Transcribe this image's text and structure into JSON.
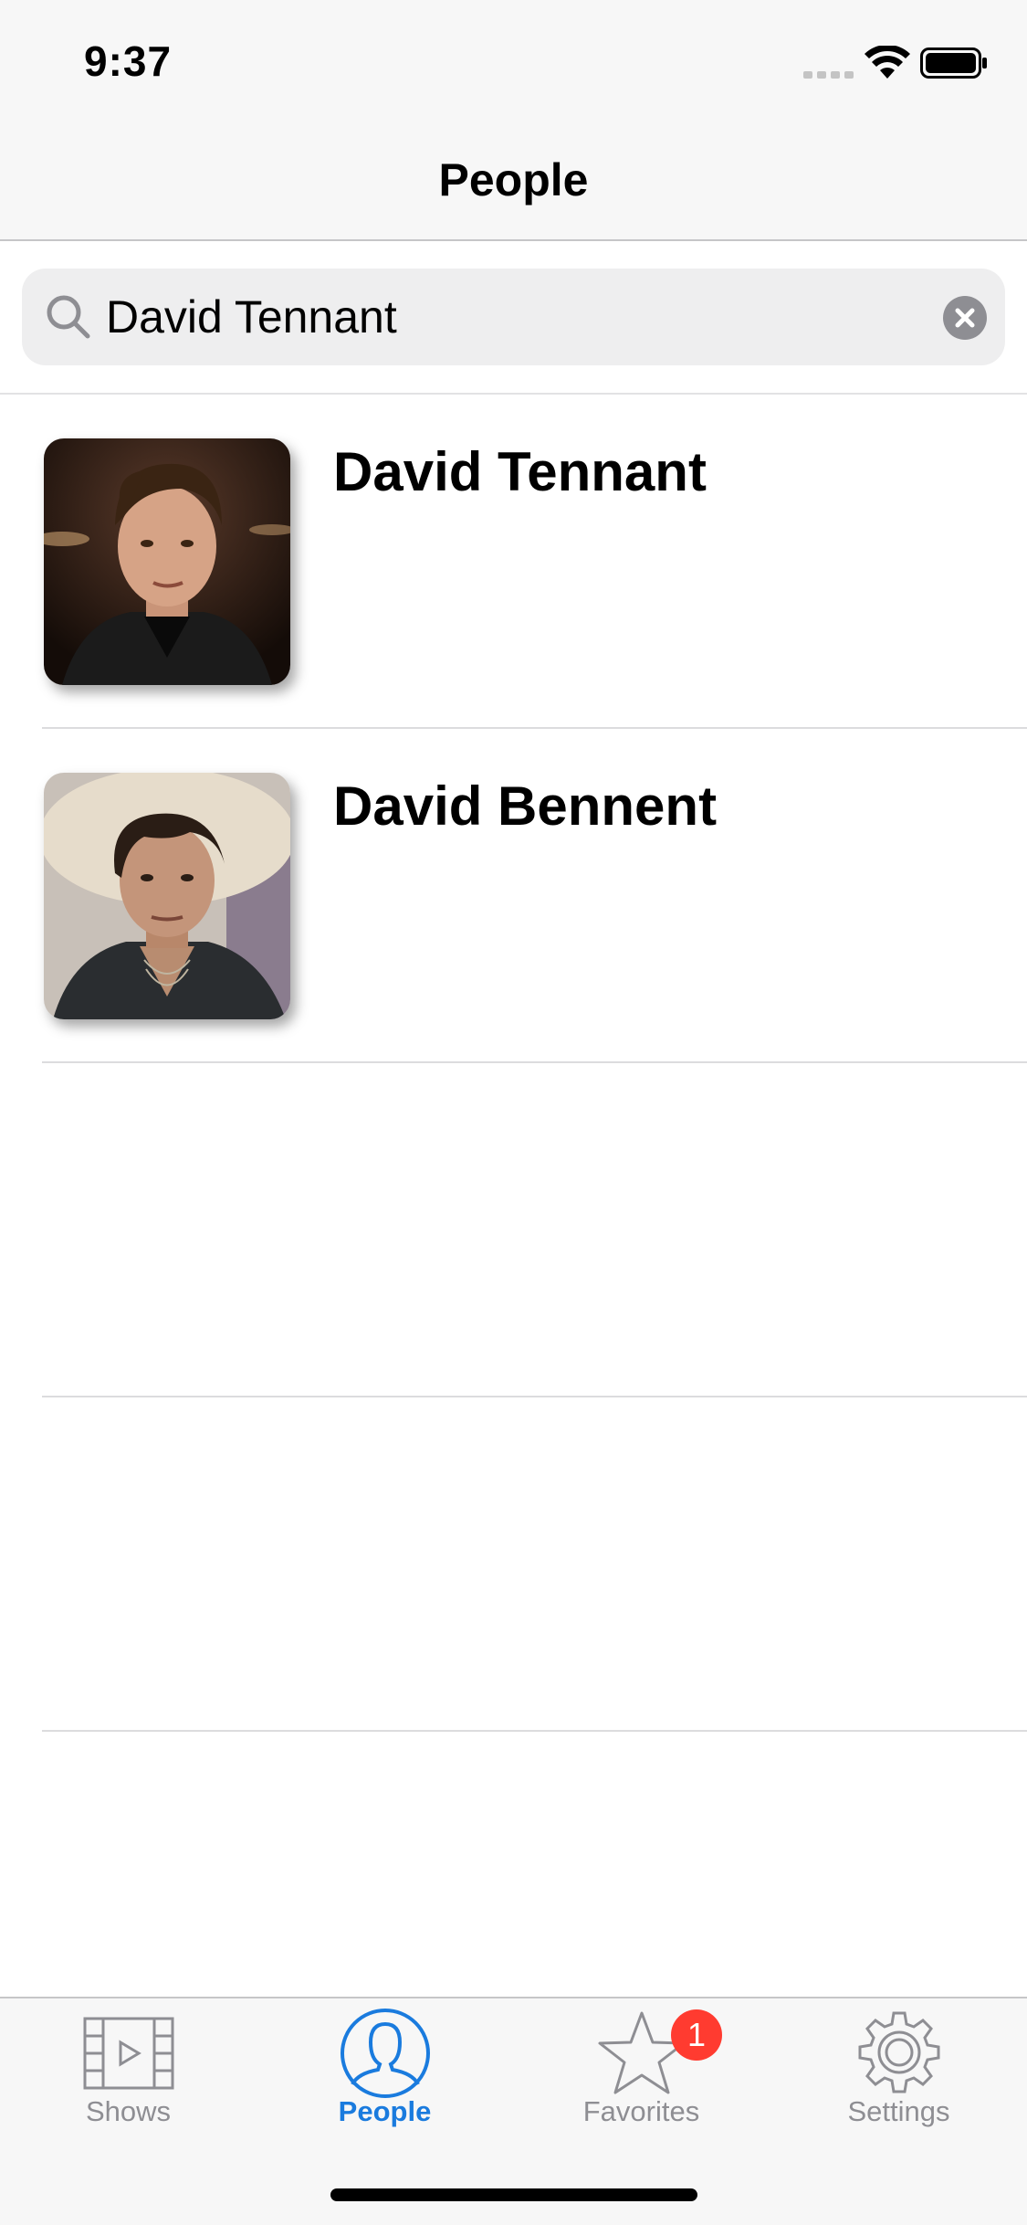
{
  "status_bar": {
    "time": "9:37"
  },
  "nav": {
    "title": "People"
  },
  "search": {
    "value": "David Tennant",
    "icon": "search-icon",
    "clear_icon": "clear-icon"
  },
  "results": [
    {
      "name": "David Tennant",
      "photo": "avatar-david-tennant"
    },
    {
      "name": "David Bennent",
      "photo": "avatar-david-bennent"
    }
  ],
  "tab_bar": {
    "active_color": "#1a7bde",
    "inactive_color": "#8e8e93",
    "tabs": [
      {
        "label": "Shows",
        "icon": "film-icon"
      },
      {
        "label": "People",
        "icon": "person-icon"
      },
      {
        "label": "Favorites",
        "icon": "star-icon",
        "badge": "1"
      },
      {
        "label": "Settings",
        "icon": "gear-icon"
      }
    ]
  }
}
